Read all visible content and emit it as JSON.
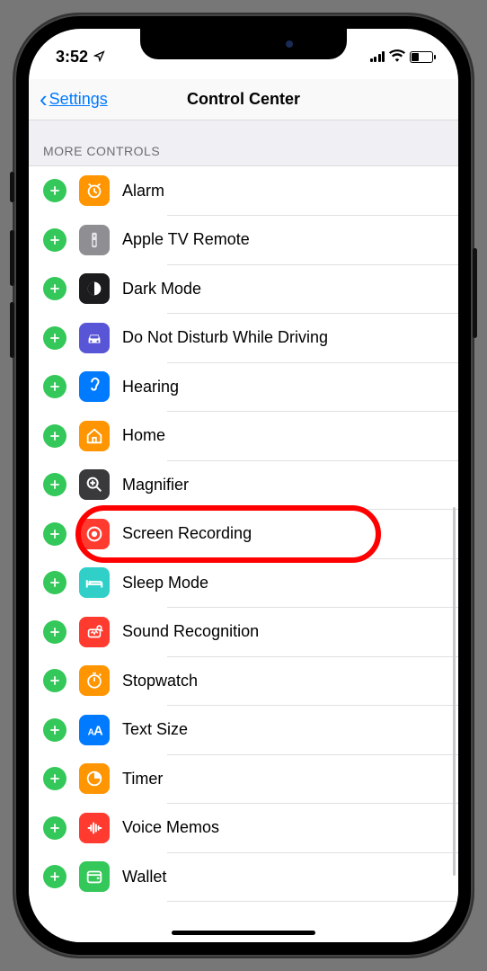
{
  "status": {
    "time": "3:52"
  },
  "nav": {
    "back_label": "Settings",
    "title": "Control Center"
  },
  "section_title": "MORE CONTROLS",
  "controls": [
    {
      "label": "Alarm",
      "icon": "alarm",
      "bg": "#ff9500"
    },
    {
      "label": "Apple TV Remote",
      "icon": "remote",
      "bg": "#8e8e93"
    },
    {
      "label": "Dark Mode",
      "icon": "darkmode",
      "bg": "#1c1c1e"
    },
    {
      "label": "Do Not Disturb While Driving",
      "icon": "car",
      "bg": "#5856d6"
    },
    {
      "label": "Hearing",
      "icon": "ear",
      "bg": "#007aff"
    },
    {
      "label": "Home",
      "icon": "home",
      "bg": "#ff9500"
    },
    {
      "label": "Magnifier",
      "icon": "magnifier",
      "bg": "#3a3a3c"
    },
    {
      "label": "Screen Recording",
      "icon": "record",
      "bg": "#ff3b30",
      "highlight": true
    },
    {
      "label": "Sleep Mode",
      "icon": "bed",
      "bg": "#30d0c9"
    },
    {
      "label": "Sound Recognition",
      "icon": "soundrec",
      "bg": "#ff3b30"
    },
    {
      "label": "Stopwatch",
      "icon": "stopwatch",
      "bg": "#ff9500"
    },
    {
      "label": "Text Size",
      "icon": "textsize",
      "bg": "#007aff"
    },
    {
      "label": "Timer",
      "icon": "timer",
      "bg": "#ff9500"
    },
    {
      "label": "Voice Memos",
      "icon": "voicememo",
      "bg": "#ff3b30"
    },
    {
      "label": "Wallet",
      "icon": "wallet",
      "bg": "#34c759"
    }
  ]
}
